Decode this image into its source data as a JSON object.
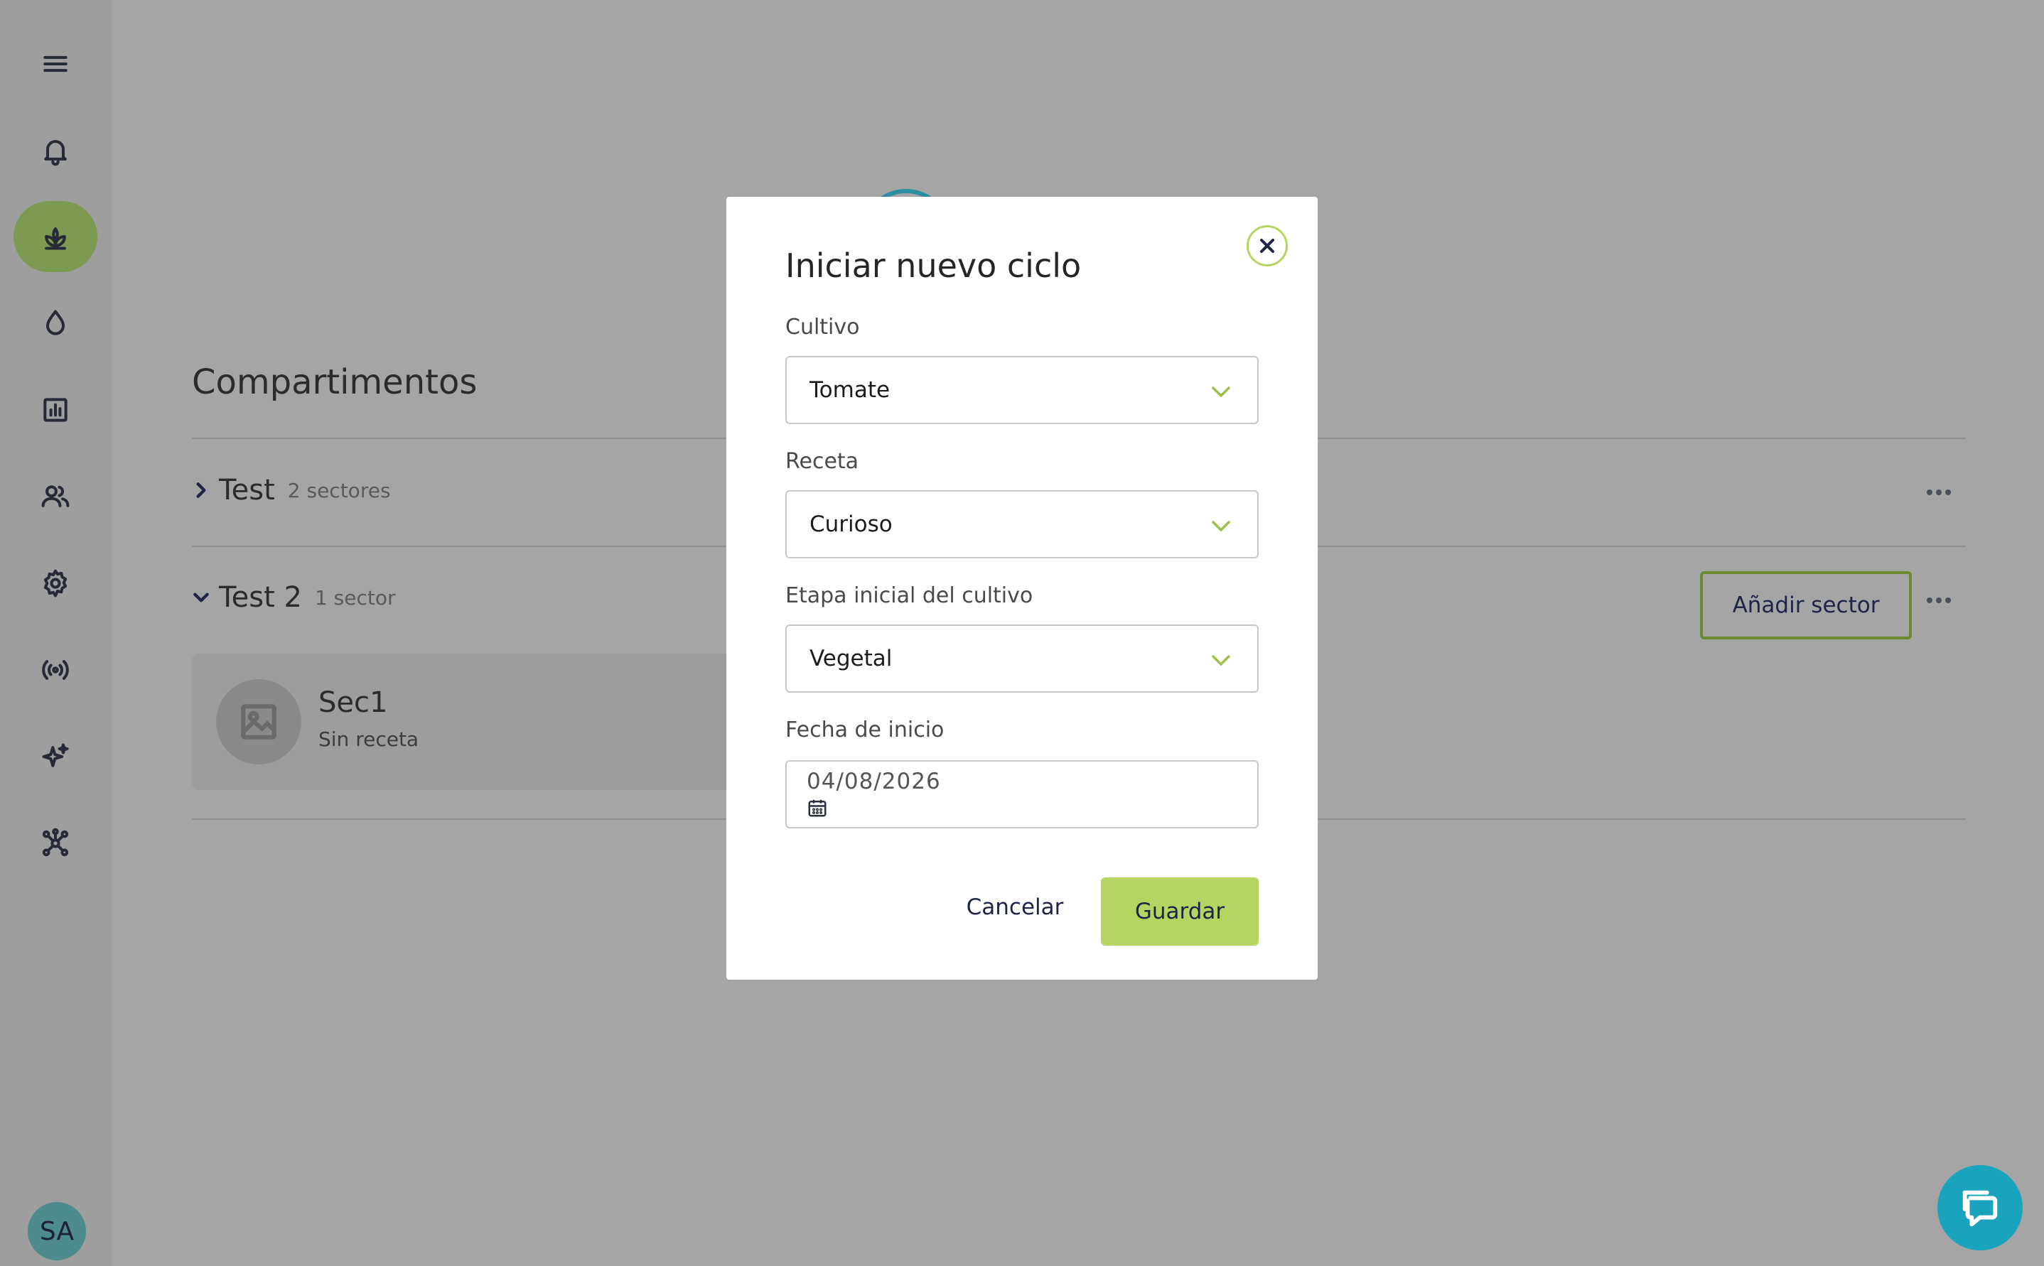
{
  "sidebar": {
    "items": [
      {
        "icon": "menu-icon"
      },
      {
        "icon": "bell-icon"
      },
      {
        "icon": "plant-icon",
        "active": true
      },
      {
        "icon": "water-drop-icon"
      },
      {
        "icon": "chart-icon"
      },
      {
        "icon": "users-icon"
      },
      {
        "icon": "gear-icon"
      },
      {
        "icon": "broadcast-icon"
      },
      {
        "icon": "sparkles-icon"
      },
      {
        "icon": "network-icon"
      }
    ],
    "avatar_initials": "SA"
  },
  "main": {
    "title": "Compartimentos",
    "groups": [
      {
        "name": "Test",
        "count": "2 sectores",
        "expanded": false
      },
      {
        "name": "Test 2",
        "count": "1 sector",
        "expanded": true,
        "add_button": "Añadir sector"
      }
    ],
    "sector": {
      "name": "Sec1",
      "subtitle": "Sin receta"
    }
  },
  "modal": {
    "title": "Iniciar nuevo ciclo",
    "fields": {
      "cultivo": {
        "label": "Cultivo",
        "value": "Tomate"
      },
      "receta": {
        "label": "Receta",
        "value": "Curioso"
      },
      "etapa": {
        "label": "Etapa inicial del cultivo",
        "value": "Vegetal"
      },
      "fecha": {
        "label": "Fecha de inicio",
        "value": "04/08/2026"
      }
    },
    "cancel_label": "Cancelar",
    "save_label": "Guardar"
  },
  "colors": {
    "accent": "#b6d461",
    "active_sidebar": "#7c9a52",
    "chat_fab": "#1aa3bd",
    "overlay": "#a5a5a5"
  }
}
